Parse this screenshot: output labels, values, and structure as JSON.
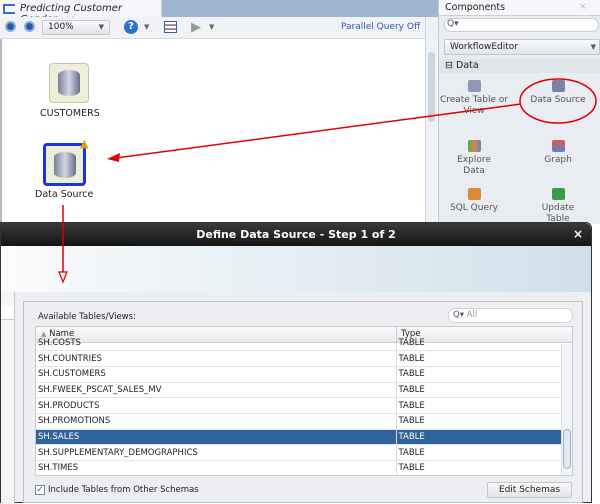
{
  "editor": {
    "tab_title": "Predicting Customer Gender",
    "zoom": "100%",
    "parallel_query": "Parallel Query Off",
    "nodes": [
      {
        "label": "CUSTOMERS"
      },
      {
        "label": "Data Source"
      }
    ]
  },
  "components": {
    "title": "Components",
    "palette": "WorkflowEditor",
    "section": "Data",
    "items": [
      {
        "label": "Create Table or View",
        "icon": "create-table-icon"
      },
      {
        "label": "Data Source",
        "icon": "data-source-icon"
      },
      {
        "label": "Explore Data",
        "icon": "explore-data-icon"
      },
      {
        "label": "Graph",
        "icon": "graph-icon"
      },
      {
        "label": "SQL Query",
        "icon": "sql-query-icon"
      },
      {
        "label": "Update Table",
        "icon": "update-table-icon"
      }
    ]
  },
  "dialog": {
    "title": "Define Data Source - Step 1 of 2",
    "close": "×",
    "available_label": "Available Tables/Views:",
    "filter_placeholder": "All",
    "columns": [
      "Name",
      "Type"
    ],
    "rows": [
      [
        "SH.COSTS",
        "TABLE"
      ],
      [
        "SH.COUNTRIES",
        "TABLE"
      ],
      [
        "SH.CUSTOMERS",
        "TABLE"
      ],
      [
        "SH.FWEEK_PSCAT_SALES_MV",
        "TABLE"
      ],
      [
        "SH.PRODUCTS",
        "TABLE"
      ],
      [
        "SH.PROMOTIONS",
        "TABLE"
      ],
      [
        "SH.SALES",
        "TABLE"
      ],
      [
        "SH.SUPPLEMENTARY_DEMOGRAPHICS",
        "TABLE"
      ],
      [
        "SH.TIMES",
        "TABLE"
      ]
    ],
    "selected_row": "SH.SALES",
    "include_other_schemas": {
      "label": "Include Tables from Other Schemas",
      "checked": true
    },
    "edit_schemas": "Edit Schemas"
  },
  "colors": {
    "selection": "#2f639b",
    "annotation": "#e00000",
    "accent": "#1f5fbf"
  }
}
